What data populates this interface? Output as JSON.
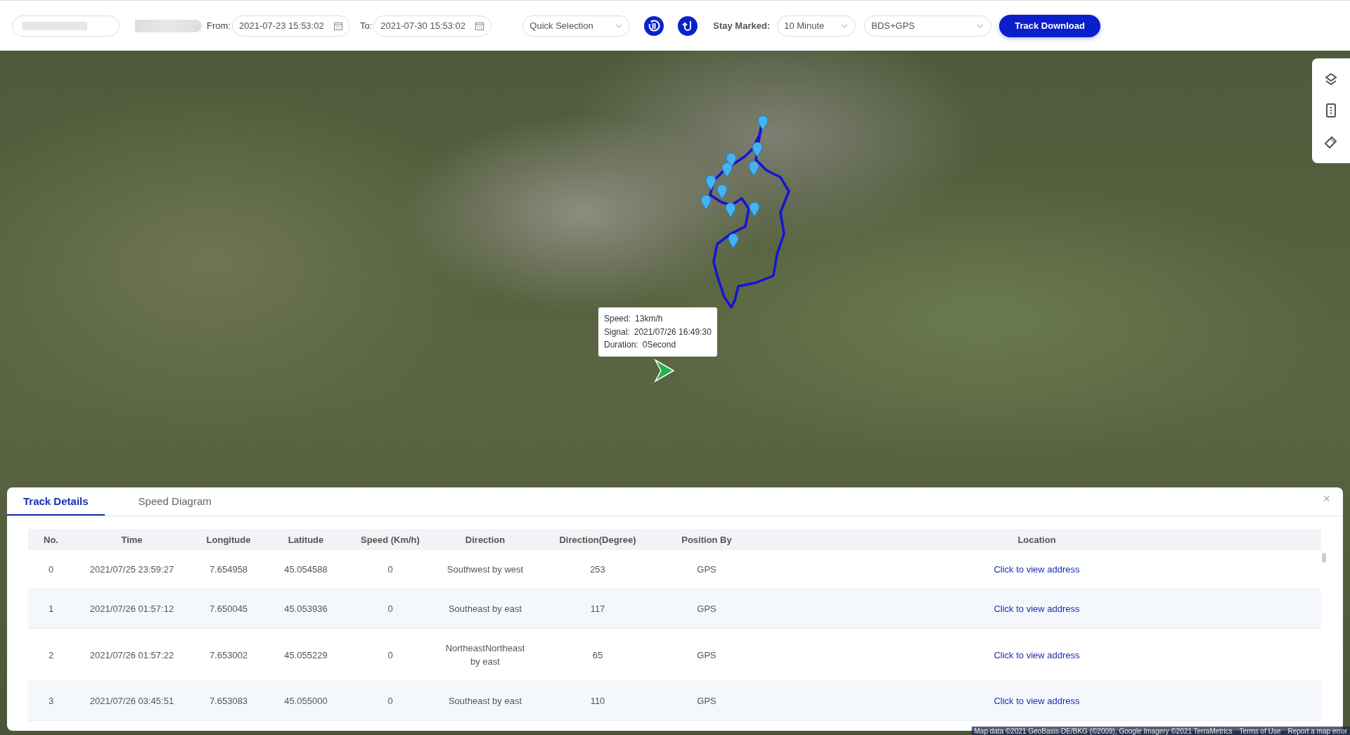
{
  "toolbar": {
    "from_label": "From:",
    "from_value": "2021-07-23 15:53:02",
    "to_label": "To:",
    "to_value": "2021-07-30 15:53:02",
    "quick_selection": "Quick Selection",
    "stay_marked_label": "Stay Marked:",
    "stay_marked_value": "10 Minute",
    "positioning": "BDS+GPS",
    "download_button": "Track Download"
  },
  "map": {
    "tooltip": [
      {
        "label": "Speed:",
        "value": "13km/h"
      },
      {
        "label": "Signal:",
        "value": "2021/07/26 16:49:30"
      },
      {
        "label": "Duration:",
        "value": "0Second"
      }
    ],
    "attribution": {
      "text": "Map data ©2021 GeoBasis-DE/BKG (©2009), Google Imagery ©2021 TerraMetrics",
      "links": [
        "Terms of Use",
        "Report a map error"
      ]
    }
  },
  "panel": {
    "tabs": [
      {
        "label": "Track Details",
        "selected": true
      },
      {
        "label": "Speed Diagram",
        "selected": false
      }
    ],
    "close": "×",
    "table": {
      "columns": [
        {
          "label": "No.",
          "kind": "text"
        },
        {
          "label": "Time",
          "kind": "text"
        },
        {
          "label": "Longitude",
          "kind": "text"
        },
        {
          "label": "Latitude",
          "kind": "text"
        },
        {
          "label": "Speed (Km/h)",
          "kind": "text"
        },
        {
          "label": "Direction",
          "kind": "text"
        },
        {
          "label": "Direction(Degree)",
          "kind": "text"
        },
        {
          "label": "Position By",
          "kind": "text"
        },
        {
          "label": "Location",
          "kind": "link"
        }
      ],
      "rows": [
        [
          "0",
          "2021/07/25 23:59:27",
          "7.654958",
          "45.054588",
          "0",
          "Southwest by west",
          "253",
          "GPS",
          "Click to view address"
        ],
        [
          "1",
          "2021/07/26 01:57:12",
          "7.650045",
          "45.053936",
          "0",
          "Southeast by east",
          "117",
          "GPS",
          "Click to view address"
        ],
        [
          "2",
          "2021/07/26 01:57:22",
          "7.653002",
          "45.055229",
          "0",
          "NortheastNortheast by east",
          "65",
          "GPS",
          "Click to view address"
        ],
        [
          "3",
          "2021/07/26 03:45:51",
          "7.653083",
          "45.055000",
          "0",
          "Southeast by east",
          "110",
          "GPS",
          "Click to view address"
        ]
      ]
    }
  }
}
